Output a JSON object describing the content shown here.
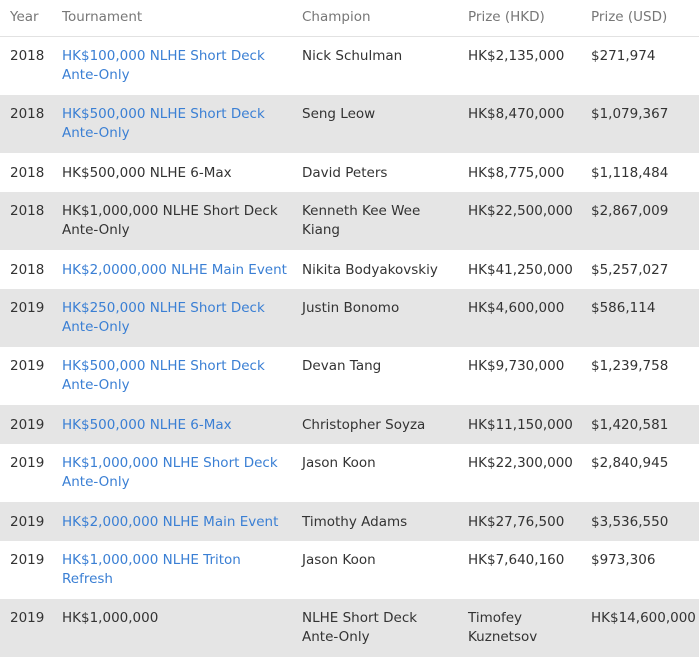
{
  "headers": [
    "Year",
    "Tournament",
    "Champion",
    "Prize (HKD)",
    "Prize (USD)"
  ],
  "rows": [
    {
      "year": "2018",
      "tournament": "HK$100,000 NLHE Short Deck Ante-Only",
      "link": true,
      "champion": "Nick Schulman",
      "hkd": "HK$2,135,000",
      "usd": "$271,974"
    },
    {
      "year": "2018",
      "tournament": "HK$500,000 NLHE Short Deck Ante-Only",
      "link": true,
      "champion": "Seng Leow",
      "hkd": "HK$8,470,000",
      "usd": "$1,079,367"
    },
    {
      "year": "2018",
      "tournament": "HK$500,000 NLHE 6-Max",
      "link": false,
      "champion": "David Peters",
      "hkd": "HK$8,775,000",
      "usd": "$1,118,484"
    },
    {
      "year": "2018",
      "tournament": "HK$1,000,000 NLHE Short Deck Ante-Only",
      "link": false,
      "champion": "Kenneth Kee Wee Kiang",
      "hkd": "HK$22,500,000",
      "usd": "$2,867,009"
    },
    {
      "year": "2018",
      "tournament": "HK$2,0000,000 NLHE Main Event",
      "link": true,
      "champion": "Nikita Bodyakovskiy",
      "hkd": "HK$41,250,000",
      "usd": "$5,257,027"
    },
    {
      "year": "2019",
      "tournament": "HK$250,000 NLHE Short Deck Ante-Only",
      "link": true,
      "champion": "Justin Bonomo",
      "hkd": "HK$4,600,000",
      "usd": "$586,114"
    },
    {
      "year": "2019",
      "tournament": "HK$500,000 NLHE Short Deck Ante-Only",
      "link": true,
      "champion": "Devan Tang",
      "hkd": "HK$9,730,000",
      "usd": "$1,239,758"
    },
    {
      "year": "2019",
      "tournament": "HK$500,000 NLHE 6-Max",
      "link": true,
      "champion": "Christopher Soyza",
      "hkd": "HK$11,150,000",
      "usd": "$1,420,581"
    },
    {
      "year": "2019",
      "tournament": "HK$1,000,000 NLHE Short Deck Ante-Only",
      "link": true,
      "champion": "Jason Koon",
      "hkd": "HK$22,300,000",
      "usd": "$2,840,945"
    },
    {
      "year": "2019",
      "tournament": "HK$2,000,000 NLHE Main Event",
      "link": true,
      "champion": "Timothy Adams",
      "hkd": "HK$27,76,500",
      "usd": "$3,536,550"
    },
    {
      "year": "2019",
      "tournament": "HK$1,000,000 NLHE Triton Refresh",
      "link": true,
      "champion": "Jason Koon",
      "hkd": "HK$7,640,160",
      "usd": "$973,306"
    },
    {
      "year": "2019",
      "tournament": "HK$1,000,000",
      "link": false,
      "champion": "NLHE Short Deck Ante-Only",
      "hkd": "Timofey Kuznetsov",
      "usd": "HK$14,600,000"
    }
  ],
  "colors": {
    "link": "#3a7fd4",
    "stripe": "#e5e5e5",
    "header_text": "#777777"
  }
}
